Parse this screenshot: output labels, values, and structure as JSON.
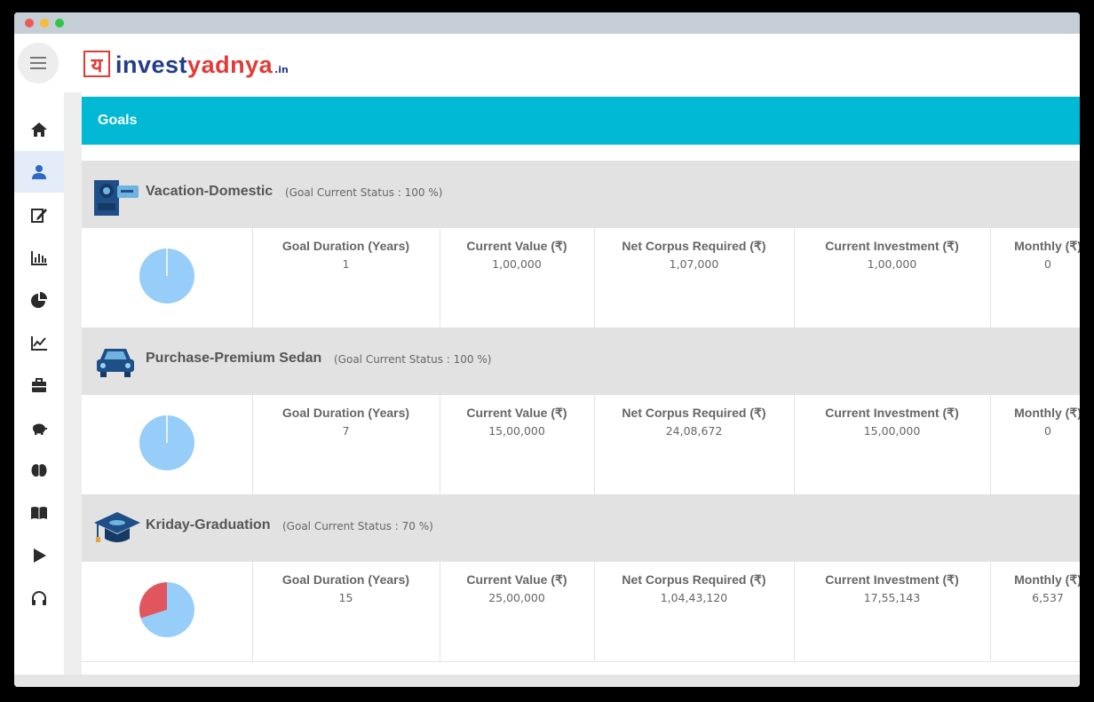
{
  "logo": {
    "devanagari": "य",
    "invest": "invest",
    "yadnya": "yadnya",
    "tld": ".in"
  },
  "sidebar": {
    "items": [
      {
        "icon": "home-icon",
        "active": false
      },
      {
        "icon": "user-icon",
        "active": true
      },
      {
        "icon": "edit-icon",
        "active": false
      },
      {
        "icon": "bar-chart-icon",
        "active": false
      },
      {
        "icon": "pie-chart-icon",
        "active": false
      },
      {
        "icon": "line-chart-icon",
        "active": false
      },
      {
        "icon": "briefcase-icon",
        "active": false
      },
      {
        "icon": "piggy-bank-icon",
        "active": false
      },
      {
        "icon": "brain-icon",
        "active": false
      },
      {
        "icon": "book-icon",
        "active": false
      },
      {
        "icon": "play-icon",
        "active": false
      },
      {
        "icon": "headphones-icon",
        "active": false
      }
    ]
  },
  "header": {
    "title": "Goals"
  },
  "columns": [
    "Goal Duration (Years)",
    "Current Value (₹)",
    "Net Corpus Required (₹)",
    "Current Investment (₹)",
    "Monthly (₹)"
  ],
  "colors": {
    "accent": "#01b9d4",
    "pie_complete": "#97cdf9",
    "pie_remaining": "#e0555e",
    "icon_dark": "#1f4f87"
  },
  "goals": [
    {
      "icon": "video-camera-icon",
      "title": "Vacation-Domestic",
      "status": "(Goal Current Status : 100 %)",
      "status_pct": 100,
      "values": [
        "1",
        "1,00,000",
        "1,07,000",
        "1,00,000",
        "0"
      ]
    },
    {
      "icon": "car-icon",
      "title": "Purchase-Premium Sedan",
      "status": "(Goal Current Status : 100 %)",
      "status_pct": 100,
      "values": [
        "7",
        "15,00,000",
        "24,08,672",
        "15,00,000",
        "0"
      ]
    },
    {
      "icon": "graduation-cap-icon",
      "title": "Kriday-Graduation",
      "status": "(Goal Current Status : 70 %)",
      "status_pct": 70,
      "values": [
        "15",
        "25,00,000",
        "1,04,43,120",
        "17,55,143",
        "6,537"
      ]
    }
  ]
}
